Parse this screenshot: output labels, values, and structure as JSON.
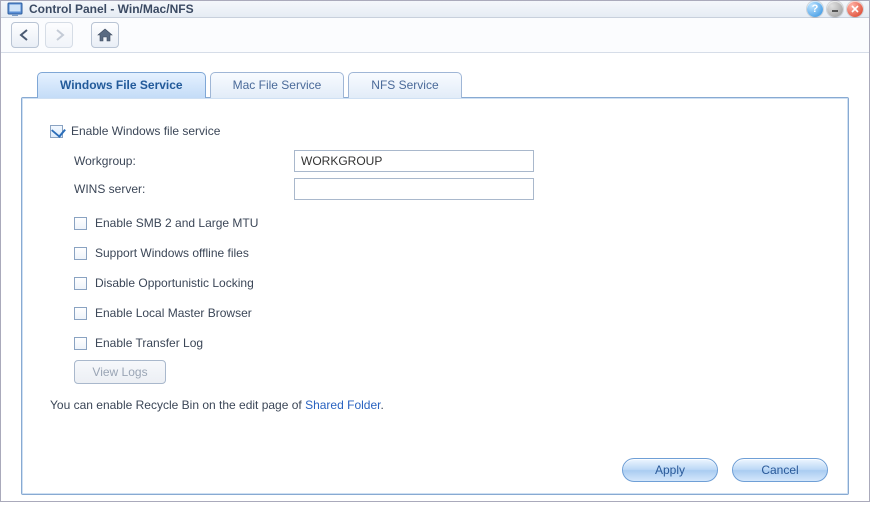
{
  "window": {
    "title": "Control Panel - Win/Mac/NFS"
  },
  "tabs": [
    {
      "label": "Windows File Service",
      "active": true
    },
    {
      "label": "Mac File Service",
      "active": false
    },
    {
      "label": "NFS Service",
      "active": false
    }
  ],
  "form": {
    "enable_service": {
      "label": "Enable Windows file service",
      "checked": true
    },
    "workgroup": {
      "label": "Workgroup:",
      "value": "WORKGROUP"
    },
    "wins": {
      "label": "WINS server:",
      "value": ""
    },
    "smb2": {
      "label": "Enable SMB 2 and Large MTU",
      "checked": false
    },
    "offline": {
      "label": "Support Windows offline files",
      "checked": false
    },
    "oplock": {
      "label": "Disable Opportunistic Locking",
      "checked": false
    },
    "lmb": {
      "label": "Enable Local Master Browser",
      "checked": false
    },
    "xferlog": {
      "label": "Enable Transfer Log",
      "checked": false
    },
    "view_logs": "View Logs",
    "info_prefix": "You can enable Recycle Bin on the edit page of ",
    "info_link": "Shared Folder",
    "info_suffix": "."
  },
  "buttons": {
    "apply": "Apply",
    "cancel": "Cancel"
  }
}
